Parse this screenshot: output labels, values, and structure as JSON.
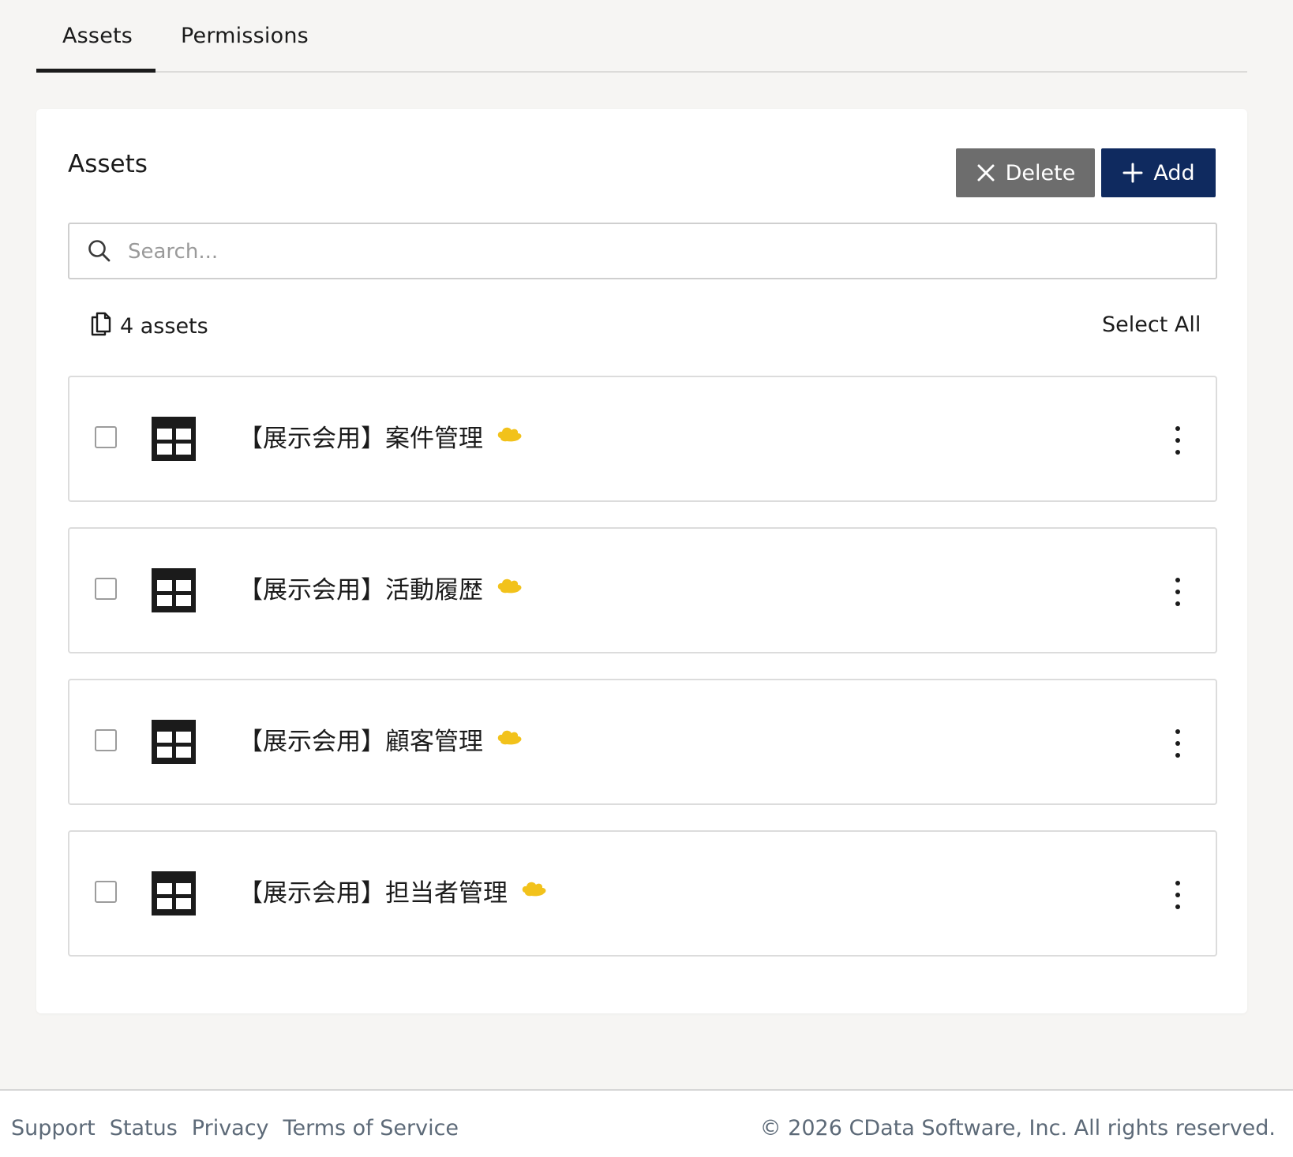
{
  "tabs": [
    {
      "label": "Assets",
      "active": true
    },
    {
      "label": "Permissions",
      "active": false
    }
  ],
  "card": {
    "title": "Assets",
    "delete_label": "Delete",
    "add_label": "Add"
  },
  "search": {
    "placeholder": "Search...",
    "value": ""
  },
  "summary": {
    "count_label": "4 assets",
    "select_all_label": "Select All"
  },
  "assets": [
    {
      "name": "【展示会用】案件管理",
      "icon": "table-icon",
      "checked": false
    },
    {
      "name": "【展示会用】活動履歴",
      "icon": "table-icon",
      "checked": false
    },
    {
      "name": "【展示会用】顧客管理",
      "icon": "table-icon",
      "checked": false
    },
    {
      "name": "【展示会用】担当者管理",
      "icon": "table-icon",
      "checked": false
    }
  ],
  "footer": {
    "links": [
      "Support",
      "Status",
      "Privacy",
      "Terms of Service"
    ],
    "copyright": "© 2026 CData Software, Inc. All rights reserved."
  },
  "colors": {
    "accent": "#0f2a5f",
    "delete": "#6d6d6d",
    "badge": "#f2c21b",
    "footer_link": "#5d6a78"
  }
}
